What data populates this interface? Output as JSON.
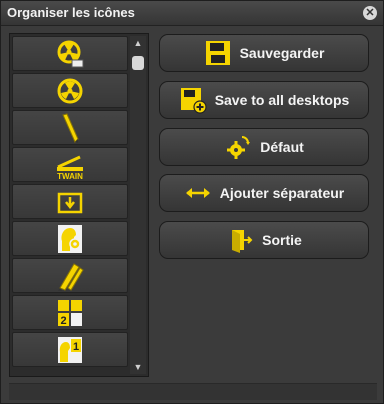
{
  "window": {
    "title": "Organiser les icônes",
    "close_symbol": "✕"
  },
  "icon_list": {
    "items": [
      {
        "icon": "scanner-radiation-icon"
      },
      {
        "icon": "radiation-icon"
      },
      {
        "icon": "pen-icon"
      },
      {
        "icon": "twain-scanner-icon",
        "text": "TWAIN"
      },
      {
        "icon": "folder-import-icon"
      },
      {
        "icon": "head-gear-icon"
      },
      {
        "icon": "pencil-ruler-icon"
      },
      {
        "icon": "grid-2-icon",
        "text": "2"
      },
      {
        "icon": "grid-1-icon",
        "text": "1"
      }
    ],
    "scroll_up": "▲",
    "scroll_down": "▼"
  },
  "buttons": {
    "save": "Sauvegarder",
    "save_all": "Save to all desktops",
    "default": "Défaut",
    "separator": "Ajouter séparateur",
    "exit": "Sortie"
  },
  "colors": {
    "accent": "#f5d400",
    "background": "#3b3b3b",
    "button_text": "#f4f4f4"
  }
}
